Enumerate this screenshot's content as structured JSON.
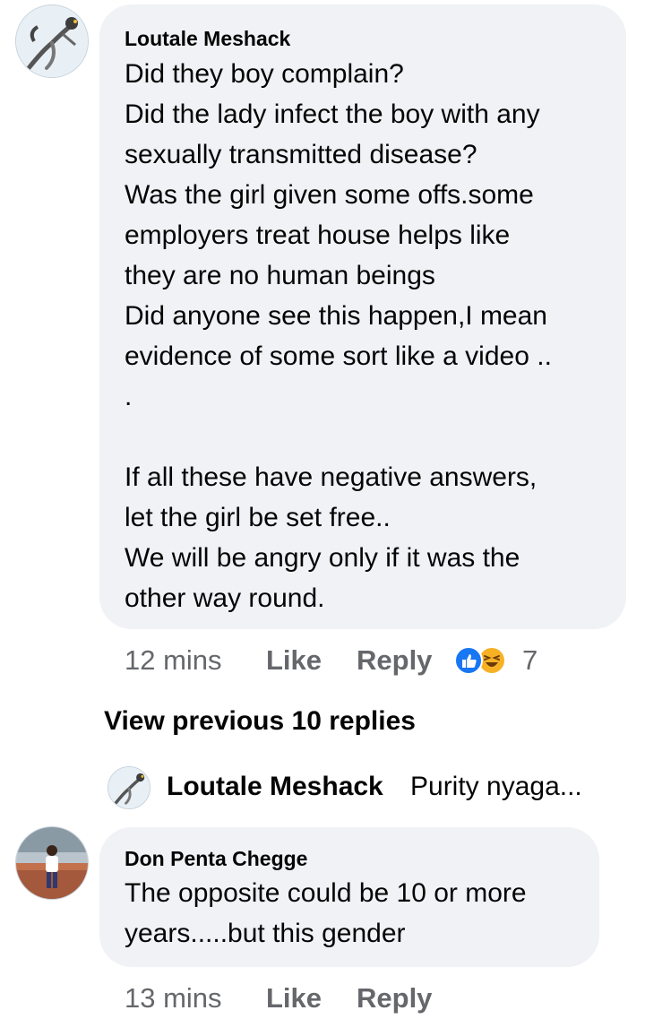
{
  "comments": [
    {
      "author": "Loutale Meshack",
      "lines": [
        "Did they boy complain?",
        "Did the lady infect the boy with any",
        "sexually transmitted disease?",
        "Was the girl given some offs.some",
        "employers treat house helps like",
        "they are no human beings",
        "Did anyone see this happen,I mean",
        "evidence of some sort like a video ..",
        ".",
        "",
        "If all these have negative answers,",
        "let the girl be set free..",
        "We will be angry only if it was the",
        "other way round."
      ],
      "time": "12 mins",
      "like_label": "Like",
      "reply_label": "Reply",
      "reaction_count": "7",
      "reactions": [
        "like-reaction-icon",
        "haha-reaction-icon"
      ]
    },
    {
      "author": "Don Penta Chegge",
      "lines": [
        "The opposite could be 10 or more",
        "years.....but this gender"
      ],
      "time": "13 mins",
      "like_label": "Like",
      "reply_label": "Reply"
    }
  ],
  "view_previous": "View previous 10 replies",
  "reply_preview": {
    "author": "Loutale Meshack",
    "text": "Purity nyaga..."
  },
  "colors": {
    "bubble": "#f0f2f5",
    "meta_text": "#65676b",
    "like_blue": "#1877f2",
    "haha_yellow": "#f7b125"
  }
}
